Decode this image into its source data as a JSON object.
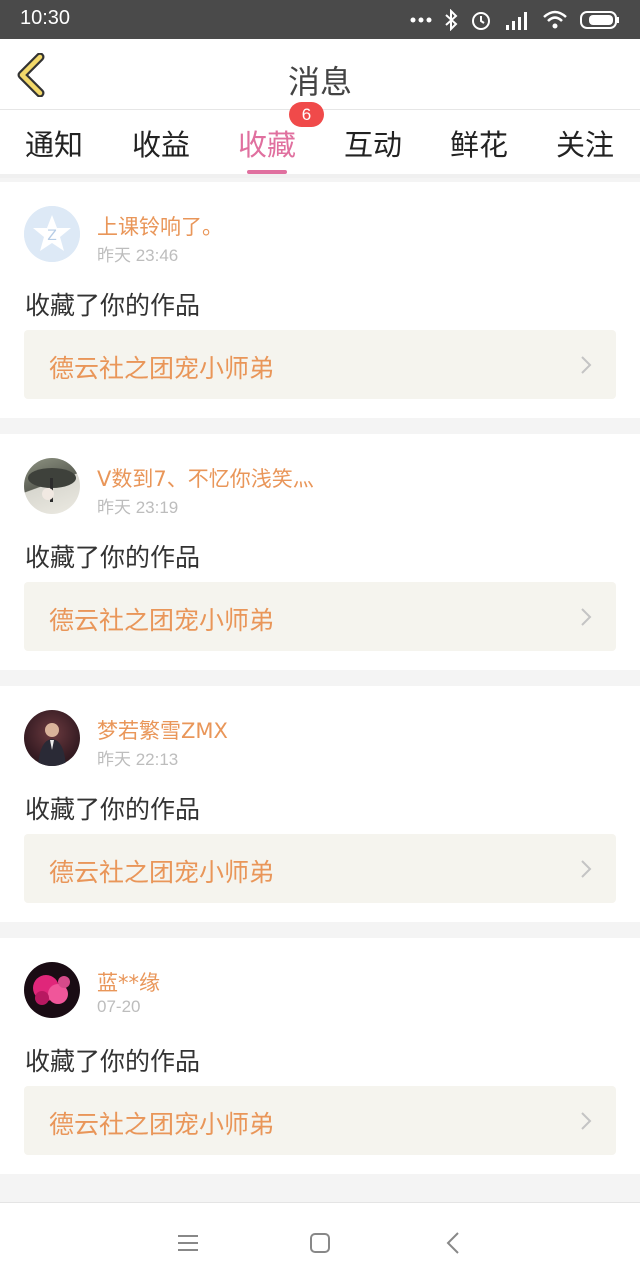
{
  "status_bar": {
    "time": "10:30"
  },
  "header": {
    "title": "消息"
  },
  "tabs": [
    {
      "label": "通知"
    },
    {
      "label": "收益"
    },
    {
      "label": "收藏",
      "badge": "6",
      "active": true
    },
    {
      "label": "互动"
    },
    {
      "label": "鲜花"
    },
    {
      "label": "关注"
    }
  ],
  "messages": [
    {
      "user": "上课铃响了。",
      "time": "昨天 23:46",
      "text": "收藏了你的作品",
      "work": "德云社之团宠小师弟"
    },
    {
      "user": "V数到7、不忆你浅笑灬",
      "time": "昨天 23:19",
      "text": "收藏了你的作品",
      "work": "德云社之团宠小师弟"
    },
    {
      "user": "梦若繁雪ZMX",
      "time": "昨天 22:13",
      "text": "收藏了你的作品",
      "work": "德云社之团宠小师弟"
    },
    {
      "user": "蓝**缘",
      "time": "07-20",
      "text": "收藏了你的作品",
      "work": "德云社之团宠小师弟"
    }
  ],
  "colors": {
    "accent": "#e0709f",
    "name": "#e99659",
    "badge": "#f04a4a"
  }
}
